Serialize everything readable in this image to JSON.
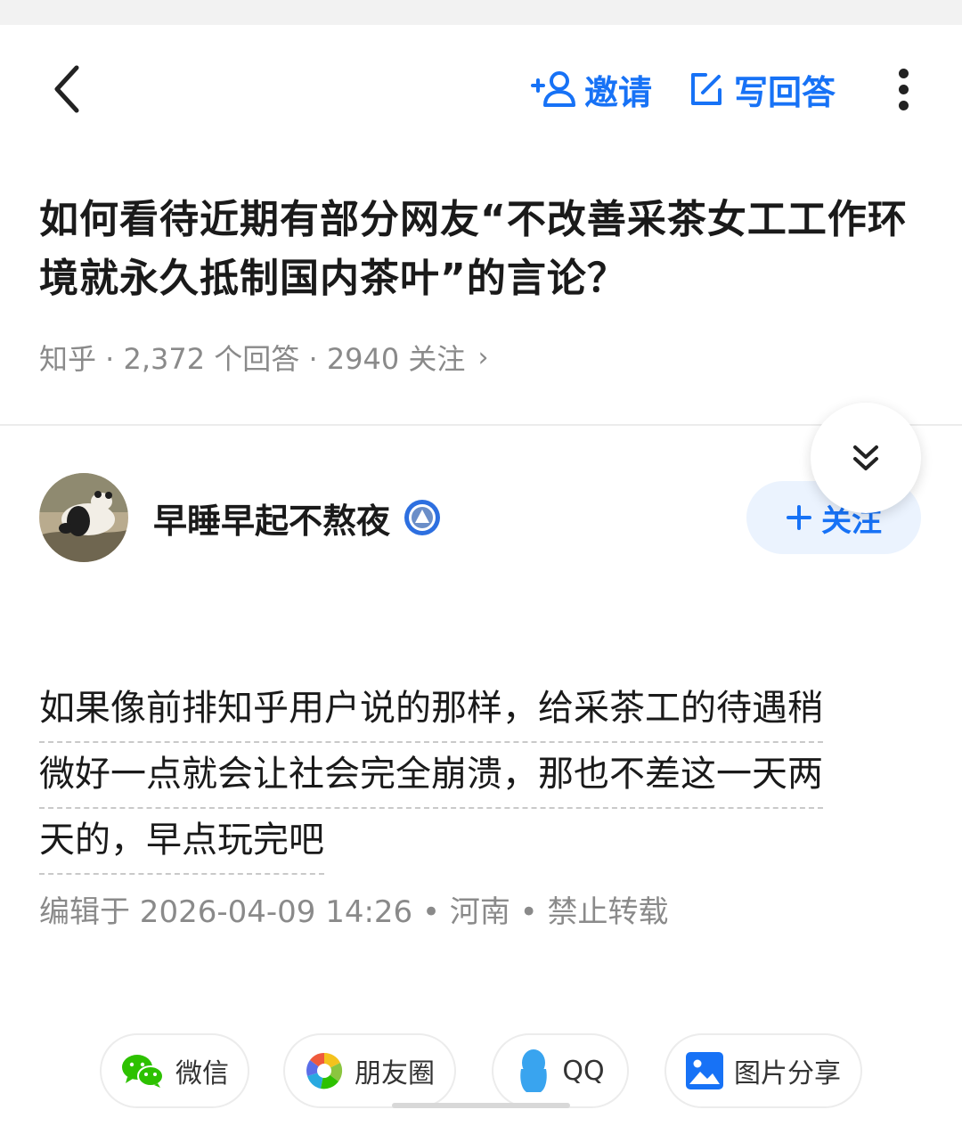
{
  "topbar": {
    "invite_label": "邀请",
    "write_answer_label": "写回答"
  },
  "question": {
    "title": "如何看待近期有部分网友“不改善采茶女工工作环境就永久抵制国内茶叶”的言论？",
    "meta": "知乎 · 2,372 个回答 · 2940 关注",
    "meta_chevron": "›"
  },
  "answer": {
    "author_name": "早睡早起不熬夜",
    "follow_label": "关注",
    "lines": [
      "如果像前排知乎用户说的那样，给采茶工的待遇稍",
      "微好一点就会让社会完全崩溃，那也不差这一天两",
      "天的，早点玩完吧"
    ],
    "edit_meta": "编辑于 2026-04-09 14:26 • 河南 • 禁止转载"
  },
  "share": {
    "wechat": "微信",
    "moments": "朋友圈",
    "qq": "QQ",
    "image": "图片分享"
  },
  "colors": {
    "accent": "#1772f6",
    "follow_bg": "#ebf3fe",
    "meta_gray": "#8a8a8a",
    "wechat_green": "#2dc100"
  },
  "icons": {
    "back": "chevron-left-icon",
    "invite": "add-user-icon",
    "write": "edit-icon",
    "more": "more-vertical-icon",
    "collapse": "double-chevron-down-icon",
    "badge": "verified-badge-icon"
  }
}
